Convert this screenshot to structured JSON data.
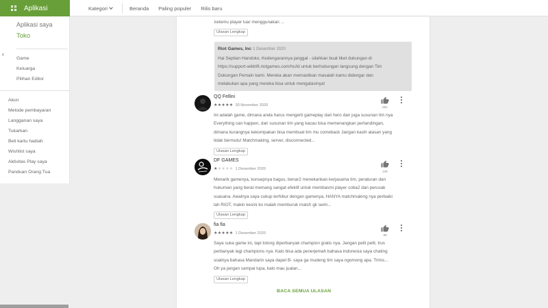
{
  "brand": {
    "label": "Aplikasi",
    "icon": "apps-grid-icon"
  },
  "nav": {
    "kategori": "Kategori",
    "beranda": "Beranda",
    "populer": "Paling populer",
    "rilis": "Rilis baru"
  },
  "sidebar": {
    "my_apps": "Aplikasi saya",
    "store": "Toko",
    "sub": [
      "Game",
      "Keluarga",
      "Pilihan Editor"
    ],
    "links": [
      "Akun",
      "Metode pembayaran",
      "Langganan saya",
      "Tukarkan",
      "Beli kartu hadiah",
      "Wishlist saya",
      "Aktivitas Play saya",
      "Panduan Orang Tua"
    ]
  },
  "colors": {
    "accent": "#689f38",
    "reply_bg": "#e0e0e0"
  },
  "top_review": {
    "text_tail": "ketemu player luar menggunakan ...",
    "full_review": "Ulasan Lengkap"
  },
  "dev_reply": {
    "name": "Riot Games, Inc",
    "date": "1 Desember 2020",
    "lines": [
      "Hai Septian Handoko, Kedengarannya janggal - silahkan buat tiket dukungan di",
      "https://support-wildrift.riotgames.com/hc/id untuk berhubungan langsung dengan Tim",
      "Dukungan Pemain kami. Mereka akan memastikan masalah kamu didengar dan",
      "melakukan apa yang mereka bisa untuk mengatasinya!"
    ]
  },
  "reviews": [
    {
      "name": "QQ Fellini",
      "rating": 5,
      "date": "30 November 2020",
      "likes": "581",
      "full_review": "Ulasan Lengkap",
      "lines": [
        "Ini adalah game, dimana anda harus mengerti gameplay dari hero dan juga susunan tim nya",
        "Everything can happen, dari susunan tim yang kacau bisa memenangkan pertandingan,",
        "dimana kurangnya kekompakan bisa membuat tim mu comeback Jangan kasih alasan yang",
        "tidak bermutu! Matchmaking, server, disconnected..."
      ]
    },
    {
      "name": "DF GAMES",
      "rating": 1,
      "date": "1 Desember 2020",
      "likes": "136",
      "full_review": "Ulasan Lengkap",
      "lines": [
        "Menarik gamenya, konsepnya bagus, benar2 menekankan kerjasama tim, peraturan dan",
        "hukuman yang berat memang sangat efektif untuk membasmi player coba2 dan perusak",
        "suasana. Awalnya saya cukup terhibur dengan gamenya, HANYA matchmaking nya perbaiki",
        "lah RIOT, makin kesini ko malah memburuk match gk seim..."
      ]
    },
    {
      "name": "fia fia",
      "rating": 5,
      "date": "1 Desember 2020",
      "likes": "98",
      "full_review": "Ulasan Lengkap",
      "lines": [
        "Saya suka game ini, tapi tolong diperbanyak champion gratis nya. Jangan pelit pelit, trus",
        "perbanyak lagi champions nya. Kalo bisa ada penerjemah bahasa indonesia saya chating",
        "soalnya bahasa Mandarin saya dapet B- saya ga mudeng tim saya ngomong apa. Trims...",
        "Oh ya jangan sampai lupa, kalo mau jualan..."
      ]
    }
  ],
  "read_all": "BACA SEMUA ULASAN"
}
